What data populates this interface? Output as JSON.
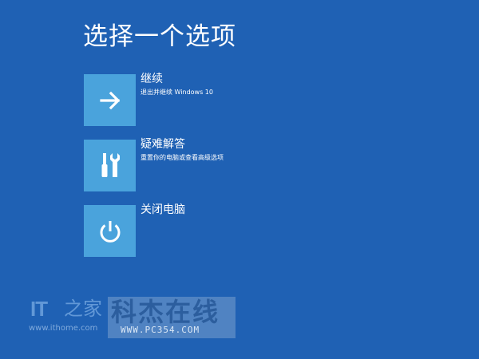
{
  "screen": {
    "title": "选择一个选项",
    "background_color": "#1f61b4",
    "tile_color": "#4aa3dc"
  },
  "options": [
    {
      "label": "继续",
      "description": "退出并继续 Windows 10",
      "icon": "arrow-right-icon"
    },
    {
      "label": "疑难解答",
      "description": "重置你的电脑或查看高级选项",
      "icon": "tools-icon"
    },
    {
      "label": "关闭电脑",
      "description": "",
      "icon": "power-icon"
    }
  ],
  "watermarks": {
    "ithome": {
      "logo_text": "IT",
      "logo_zh": "之家",
      "url": "www.ithome.com"
    },
    "pc354": {
      "title": "科杰在线",
      "url": "WWW.PC354.COM"
    }
  }
}
